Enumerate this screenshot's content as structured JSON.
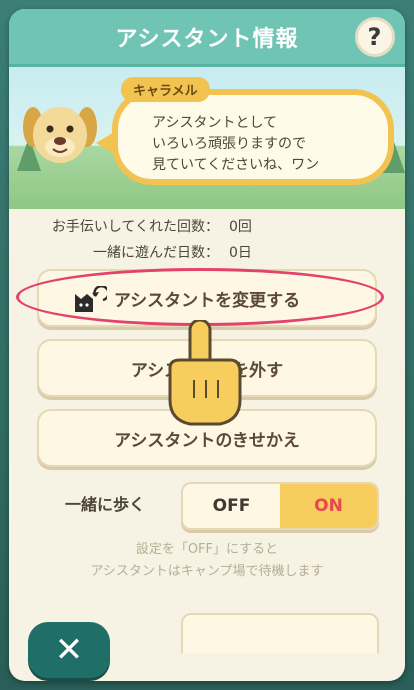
{
  "header": {
    "title": "アシスタント情報",
    "help_label": "?"
  },
  "assistant": {
    "name": "キャラメル",
    "message": "アシスタントとして\nいろいろ頑張りますので\n見ていてくださいね、ワン"
  },
  "stats": [
    {
      "label": "お手伝いしてくれた回数：",
      "value": "0回"
    },
    {
      "label": "一緒に遊んだ日数：",
      "value": "0日"
    }
  ],
  "buttons": {
    "change": "アシスタントを変更する",
    "remove": "アシスタントを外す",
    "dress": "アシスタントのきせかえ"
  },
  "walk_toggle": {
    "label": "一緒に歩く",
    "off_label": "OFF",
    "on_label": "ON",
    "selected": "ON"
  },
  "note": "設定を「OFF」にすると\nアシスタントはキャンプ場で待機します",
  "close_label": "✕",
  "colors": {
    "accent_teal": "#6fc4b4",
    "highlight": "#e3436a",
    "on_color": "#e8484f"
  }
}
